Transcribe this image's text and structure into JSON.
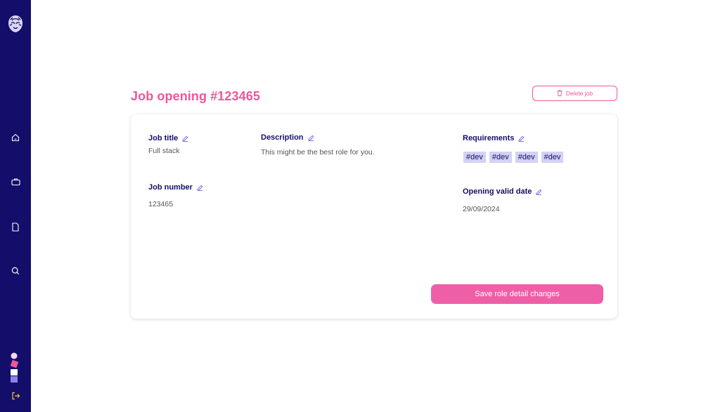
{
  "colors": {
    "sidebar_bg": "#130e6a",
    "accent_pink": "#f0569c",
    "tag_bg": "#d4d1f4",
    "label_navy": "#130e6a"
  },
  "sidebar": {
    "logo_icon": "lion-head-logo",
    "items": [
      {
        "icon": "home-icon"
      },
      {
        "icon": "briefcase-icon"
      },
      {
        "icon": "document-icon"
      },
      {
        "icon": "search-icon"
      }
    ],
    "logout_icon": "logout-icon"
  },
  "header": {
    "title": "Job opening #123465",
    "delete_label": "Delete job"
  },
  "job": {
    "title_label": "Job title",
    "title_value": "Full stack",
    "description_label": "Description",
    "description_value": "This might be the best role for you.",
    "requirements_label": "Requirements",
    "requirements_tags": [
      "#dev",
      "#dev",
      "#dev",
      "#dev"
    ],
    "number_label": "Job number",
    "number_value": "123465",
    "valid_date_label": "Opening valid date",
    "valid_date_value": "29/09/2024"
  },
  "actions": {
    "save_label": "Save role detail changes"
  }
}
